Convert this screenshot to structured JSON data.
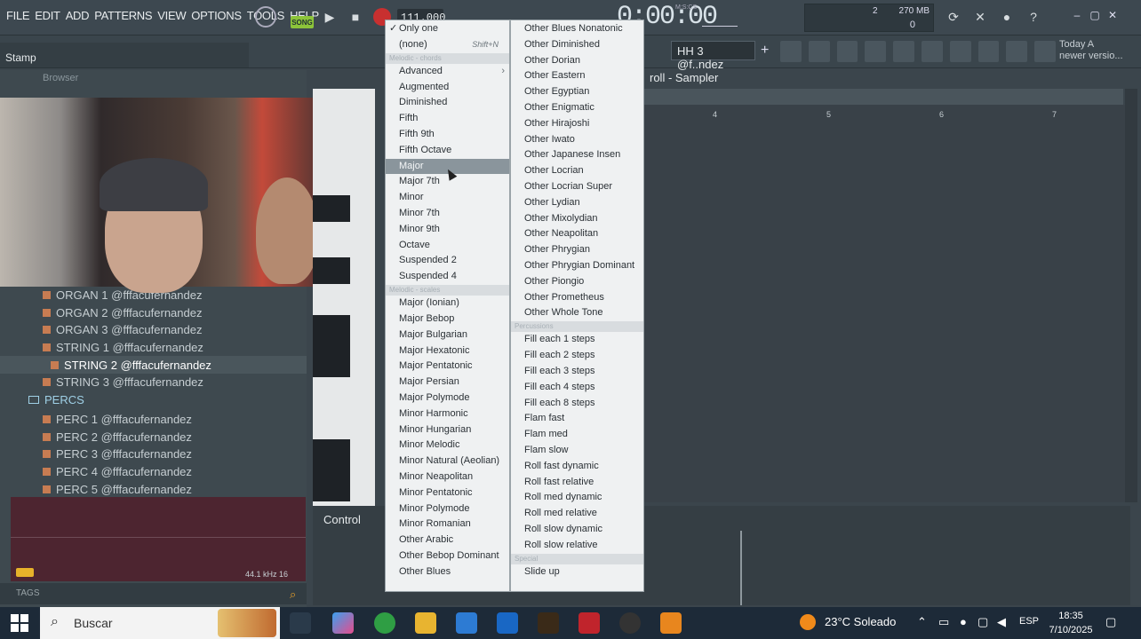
{
  "menu_bar": {
    "items": [
      "FILE",
      "EDIT",
      "ADD",
      "PATTERNS",
      "VIEW",
      "OPTIONS",
      "TOOLS",
      "HELP"
    ]
  },
  "transport": {
    "song_label": "SONG",
    "tempo": "111.000",
    "time": "0:00:00",
    "time_unit": "M:S:CS"
  },
  "cpu_panel": {
    "value1": "2",
    "memory": "270 MB",
    "value2": "0"
  },
  "hint_bar": {
    "text": "Stamp"
  },
  "pattern_selector": {
    "value": "HH 3 @f..ndez"
  },
  "news": {
    "line1": "Today A",
    "line2": "newer versio..."
  },
  "browser": {
    "title": "Browser",
    "items": [
      {
        "label": "ORGAN 1 @fffacufernandez",
        "type": "file"
      },
      {
        "label": "ORGAN 2 @fffacufernandez",
        "type": "file"
      },
      {
        "label": "ORGAN 3 @fffacufernandez",
        "type": "file"
      },
      {
        "label": "STRING 1 @fffacufernandez",
        "type": "file"
      },
      {
        "label": "STRING 2 @fffacufernandez",
        "type": "file",
        "selected": true
      },
      {
        "label": "STRING 3 @fffacufernandez",
        "type": "file"
      },
      {
        "label": "PERCS",
        "type": "folder"
      },
      {
        "label": "PERC 1 @fffacufernandez",
        "type": "file"
      },
      {
        "label": "PERC 2 @fffacufernandez",
        "type": "file"
      },
      {
        "label": "PERC 3 @fffacufernandez",
        "type": "file"
      },
      {
        "label": "PERC 4 @fffacufernandez",
        "type": "file"
      },
      {
        "label": "PERC 5 @fffacufernandez",
        "type": "file"
      }
    ],
    "sample_info": "44.1 kHz 16",
    "tags_label": "TAGS"
  },
  "piano_roll": {
    "title": "roll - Sampler",
    "ruler": [
      "4",
      "5",
      "6",
      "7"
    ],
    "control_label": "Control"
  },
  "stamp_menu_left": {
    "items": [
      {
        "label": "Only one",
        "checked": true
      },
      {
        "label": "(none)",
        "shortcut": "Shift+N"
      },
      {
        "header": "Melodic - chords"
      },
      {
        "label": "Advanced",
        "submenu": true
      },
      {
        "label": "Augmented"
      },
      {
        "label": "Diminished"
      },
      {
        "label": "Fifth"
      },
      {
        "label": "Fifth 9th"
      },
      {
        "label": "Fifth Octave"
      },
      {
        "label": "Major",
        "highlighted": true
      },
      {
        "label": "Major 7th"
      },
      {
        "label": "Minor"
      },
      {
        "label": "Minor 7th"
      },
      {
        "label": "Minor 9th"
      },
      {
        "label": "Octave"
      },
      {
        "label": "Suspended 2"
      },
      {
        "label": "Suspended 4"
      },
      {
        "header": "Melodic - scales"
      },
      {
        "label": "Major (Ionian)"
      },
      {
        "label": "Major Bebop"
      },
      {
        "label": "Major Bulgarian"
      },
      {
        "label": "Major Hexatonic"
      },
      {
        "label": "Major Pentatonic"
      },
      {
        "label": "Major Persian"
      },
      {
        "label": "Major Polymode"
      },
      {
        "label": "Minor Harmonic"
      },
      {
        "label": "Minor Hungarian"
      },
      {
        "label": "Minor Melodic"
      },
      {
        "label": "Minor Natural (Aeolian)"
      },
      {
        "label": "Minor Neapolitan"
      },
      {
        "label": "Minor Pentatonic"
      },
      {
        "label": "Minor Polymode"
      },
      {
        "label": "Minor Romanian"
      },
      {
        "label": "Other Arabic"
      },
      {
        "label": "Other Bebop Dominant"
      },
      {
        "label": "Other Blues"
      }
    ]
  },
  "stamp_menu_right": {
    "items": [
      {
        "label": "Other Blues Nonatonic"
      },
      {
        "label": "Other Diminished"
      },
      {
        "label": "Other Dorian"
      },
      {
        "label": "Other Eastern"
      },
      {
        "label": "Other Egyptian"
      },
      {
        "label": "Other Enigmatic"
      },
      {
        "label": "Other Hirajoshi"
      },
      {
        "label": "Other Iwato"
      },
      {
        "label": "Other Japanese Insen"
      },
      {
        "label": "Other Locrian"
      },
      {
        "label": "Other Locrian Super"
      },
      {
        "label": "Other Lydian"
      },
      {
        "label": "Other Mixolydian"
      },
      {
        "label": "Other Neapolitan"
      },
      {
        "label": "Other Phrygian"
      },
      {
        "label": "Other Phrygian Dominant"
      },
      {
        "label": "Other Piongio"
      },
      {
        "label": "Other Prometheus"
      },
      {
        "label": "Other Whole Tone"
      },
      {
        "header": "Percussions"
      },
      {
        "label": "Fill each 1 steps"
      },
      {
        "label": "Fill each 2 steps"
      },
      {
        "label": "Fill each 3 steps"
      },
      {
        "label": "Fill each 4 steps"
      },
      {
        "label": "Fill each 8 steps"
      },
      {
        "label": "Flam fast"
      },
      {
        "label": "Flam med"
      },
      {
        "label": "Flam slow"
      },
      {
        "label": "Roll fast dynamic"
      },
      {
        "label": "Roll fast relative"
      },
      {
        "label": "Roll med dynamic"
      },
      {
        "label": "Roll med relative"
      },
      {
        "label": "Roll slow dynamic"
      },
      {
        "label": "Roll slow relative"
      },
      {
        "header": "Special"
      },
      {
        "label": "Slide up"
      }
    ]
  },
  "taskbar": {
    "search_placeholder": "Buscar",
    "weather": "23°C Soleado",
    "language": "ESP",
    "time": "18:35",
    "date": "7/10/2025"
  },
  "colors": {
    "accent_green": "#8cc43a",
    "menu_bg": "#eff1f2",
    "highlight": "#8a959c",
    "browser_bg": "#3e494f"
  }
}
